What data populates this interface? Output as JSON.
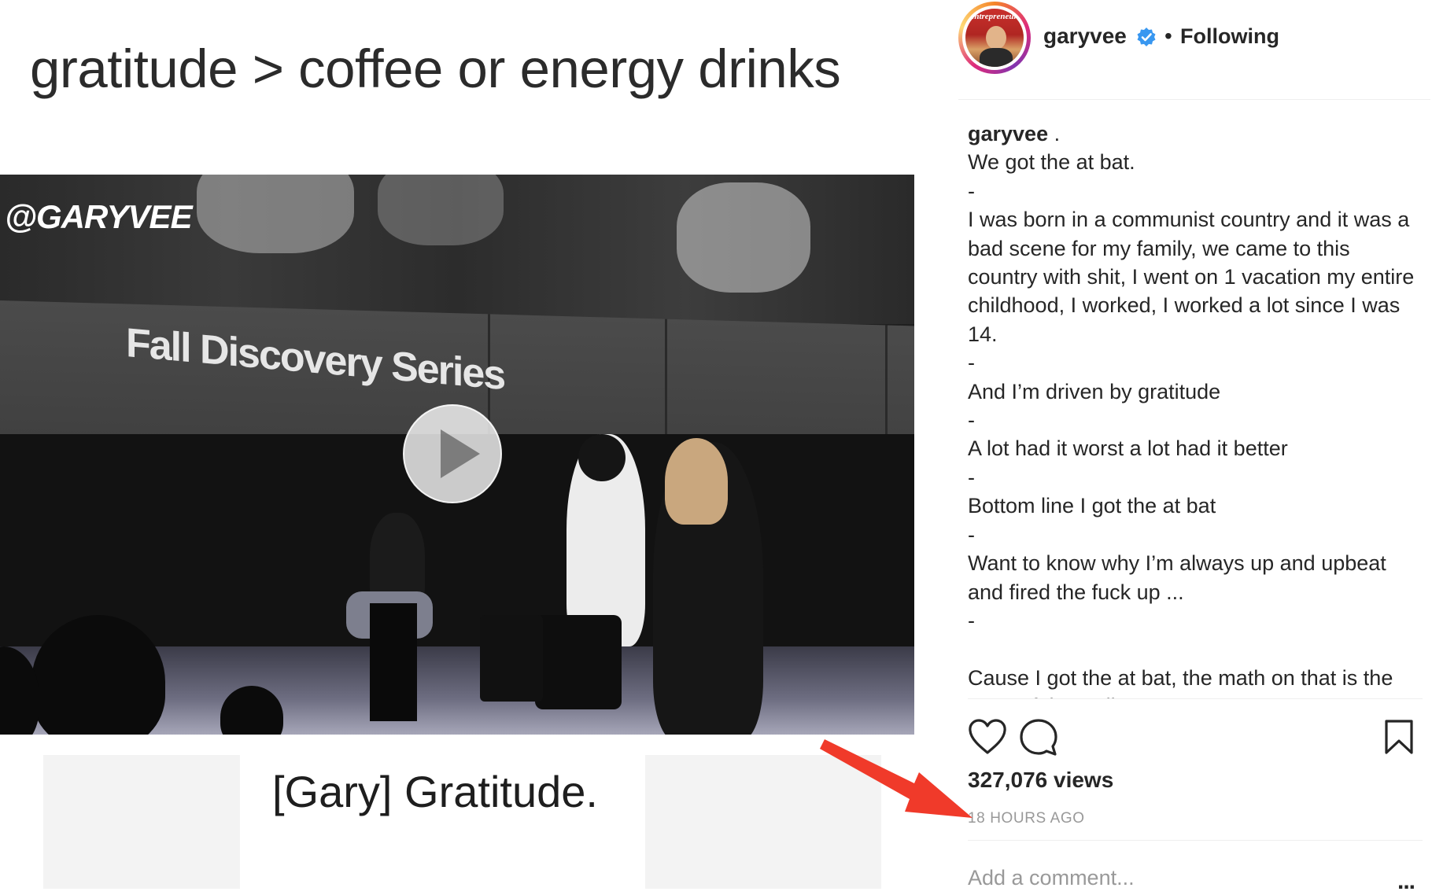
{
  "media": {
    "title": "gratitude > coffee or energy drinks",
    "watermark": "@GARYVEE",
    "banner_text": "Fall Discovery Series",
    "caption": "[Gary] Gratitude.",
    "play_icon": "play-icon"
  },
  "header": {
    "username": "garyvee",
    "verified_icon": "verified-badge-icon",
    "separator": "•",
    "follow_status": "Following",
    "avatar_text": "Entrepreneur"
  },
  "caption": {
    "username": "garyvee",
    "username_suffix": " .",
    "lines": [
      "We got the at bat.",
      "-",
      "I was born in a communist country and it was a bad scene for my family, we came to this country with shit, I went on 1 vacation my entire childhood, I worked, I worked a lot since I was 14.",
      "-",
      "And I’m driven by gratitude",
      "-",
      "A lot had it worst a lot had it better",
      "-",
      "Bottom line I got the at bat",
      "-",
      "Want to know why I’m always up and upbeat and fired the fuck up ...",
      "-",
      "",
      "Cause I got the at bat, the math on that is the most of the wall!!"
    ]
  },
  "actions": {
    "like_icon": "heart-icon",
    "comment_icon": "comment-bubble-icon",
    "save_icon": "bookmark-icon"
  },
  "stats": {
    "views": "327,076 views",
    "time_ago": "18 HOURS AGO"
  },
  "comment": {
    "placeholder": "Add a comment...",
    "more_label": "..."
  },
  "annotation": {
    "arrow_color": "#f03a2a"
  },
  "colors": {
    "text": "#262626",
    "muted": "#999999",
    "divider": "#efefef",
    "verified": "#3897f0"
  }
}
